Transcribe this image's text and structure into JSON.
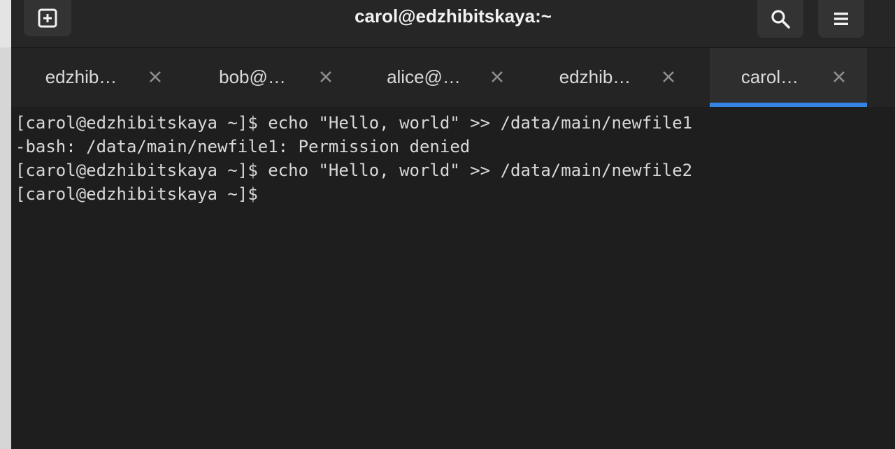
{
  "window": {
    "title": "carol@edzhibitskaya:~"
  },
  "header": {
    "new_tab_icon": "new-tab-icon",
    "search_icon": "search-icon",
    "menu_icon": "hamburger-menu-icon"
  },
  "tabs": [
    {
      "label": "edzhib…",
      "active": false
    },
    {
      "label": "bob@…",
      "active": false
    },
    {
      "label": "alice@…",
      "active": false
    },
    {
      "label": "edzhib…",
      "active": false
    },
    {
      "label": "carol…",
      "active": true
    }
  ],
  "terminal": {
    "lines": [
      "[carol@edzhibitskaya ~]$ echo \"Hello, world\" >> /data/main/newfile1",
      "-bash: /data/main/newfile1: Permission denied",
      "[carol@edzhibitskaya ~]$ echo \"Hello, world\" >> /data/main/newfile2",
      "[carol@edzhibitskaya ~]$ "
    ]
  },
  "colors": {
    "accent": "#3584e4",
    "background": "#1e1e1e",
    "text": "#d8d8d8"
  }
}
